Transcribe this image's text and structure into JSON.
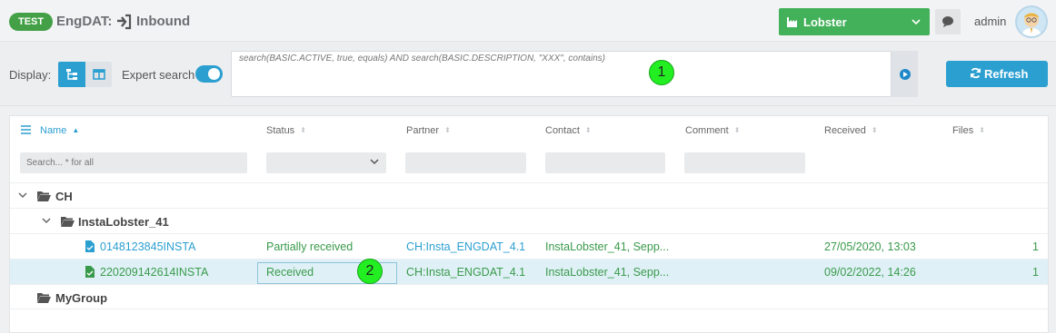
{
  "header": {
    "badge": "TEST",
    "app_name": "EngDAT:",
    "page_title": "Inbound",
    "profile": "Lobster",
    "user": "admin"
  },
  "toolbar": {
    "display_label": "Display:",
    "expert_label": "Expert search",
    "expert_on": true,
    "query": "search(BASIC.ACTIVE, true, equals) AND search(BASIC.DESCRIPTION, \"XXX\", contains)",
    "refresh_label": "Refresh"
  },
  "markers": [
    "1",
    "2"
  ],
  "grid": {
    "columns": [
      "Name",
      "Status",
      "Partner",
      "Contact",
      "Comment",
      "Received",
      "Files"
    ],
    "filter_placeholder": "Search... * for all",
    "groups": [
      {
        "label": "CH"
      },
      {
        "label": "InstaLobster_41"
      },
      {
        "label": "MyGroup"
      }
    ],
    "rows": [
      {
        "name": "0148123845INSTA",
        "status": "Partially received",
        "partner": "CH:Insta_ENGDAT_4.1",
        "contact": "InstaLobster_41, Sepp...",
        "comment": "",
        "received": "27/05/2020, 13:03",
        "files": "1"
      },
      {
        "name": "220209142614INSTA",
        "status": "Received",
        "partner": "CH:Insta_ENGDAT_4.1",
        "contact": "InstaLobster_41, Sepp...",
        "comment": "",
        "received": "09/02/2022, 14:26",
        "files": "1"
      }
    ]
  },
  "colors": {
    "accent": "#2c9fd1",
    "success": "#43a047",
    "text_green": "#3a9a4b"
  }
}
